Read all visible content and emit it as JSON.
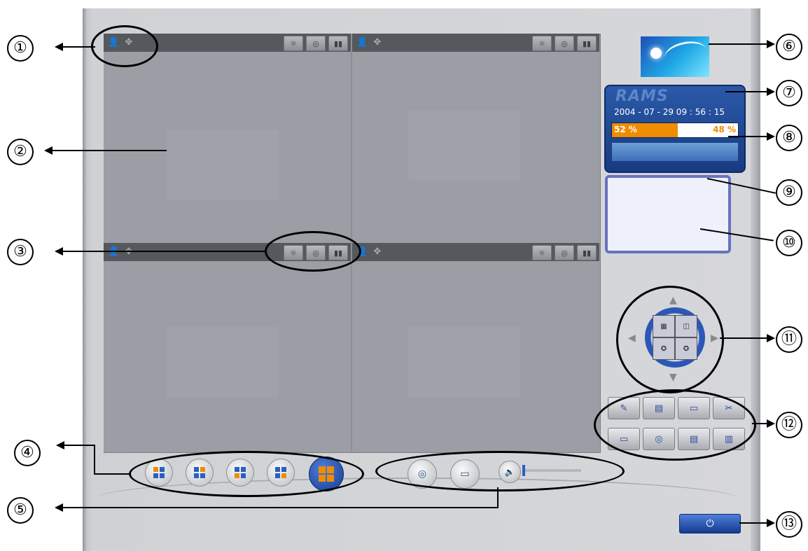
{
  "callouts": {
    "c1": "①",
    "c2": "②",
    "c3": "③",
    "c4": "④",
    "c5": "⑤",
    "c6": "⑥",
    "c7": "⑦",
    "c8": "⑧",
    "c9": "⑨",
    "c10": "⑩",
    "c11": "⑪",
    "c12": "⑫",
    "c13": "⑬"
  },
  "info_panel": {
    "brand": "RAMS",
    "datetime": "2004 - 07 - 29  09 : 56 : 15",
    "disk_used_label": "52 %",
    "disk_used_value": 52,
    "disk_free_label": "48 %"
  },
  "icons": {
    "camera_ctrl": "person-move-icon",
    "pane_tools": [
      "brightness-icon",
      "snapshot-icon",
      "record-icon"
    ],
    "record": "camera-record-icon",
    "playback": "film-icon",
    "volume": "speaker-icon",
    "power": "power-icon"
  },
  "colors": {
    "accent_blue": "#2b5fc2",
    "accent_orange": "#f08c00",
    "pane_bg": "#9b9ea4",
    "pane_bar": "#55585c"
  },
  "glyphs": {
    "pane_ctrl": "👤 ✥",
    "brightness": "☼",
    "snapshot": "◎",
    "record": "▮▮",
    "ptz_up": "▲",
    "ptz_down": "▼",
    "ptz_left": "◀",
    "ptz_right": "▶",
    "q1": "▦",
    "q2": "◫",
    "q3": "✪",
    "q4": "✪",
    "fn1": "✎",
    "fn2": "▤",
    "fn3": "▭",
    "fn4": "✂",
    "fn5": "▭",
    "fn6": "◎",
    "fn7": "▤",
    "fn8": "▥",
    "rec": "◎",
    "play": "▭",
    "vol": "🔈",
    "power": "⏻"
  }
}
